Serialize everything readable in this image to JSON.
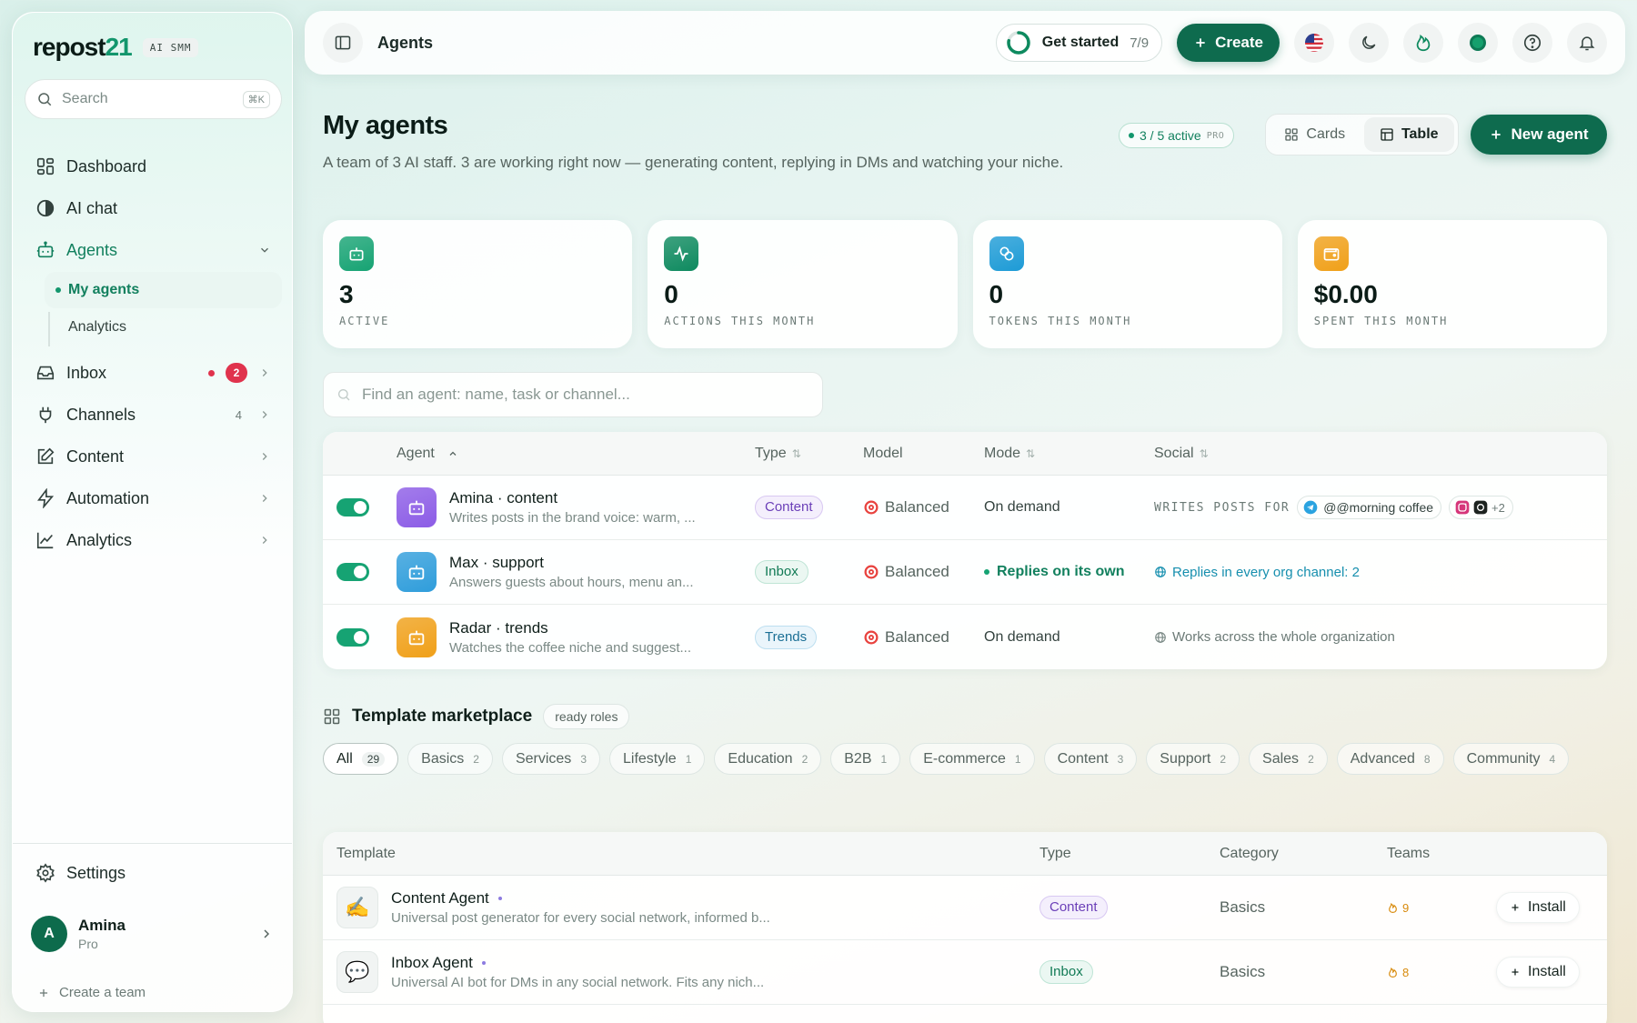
{
  "brand": {
    "logo_main": "repost",
    "logo_num": "21",
    "badge": "AI SMM"
  },
  "search": {
    "placeholder": "Search",
    "shortcut": "⌘K"
  },
  "nav": {
    "dashboard": "Dashboard",
    "ai_chat": "AI chat",
    "agents": "Agents",
    "agents_sub": [
      "My agents",
      "Analytics"
    ],
    "inbox": "Inbox",
    "inbox_count": "2",
    "channels": "Channels",
    "channels_count": "4",
    "content": "Content",
    "automation": "Automation",
    "analytics": "Analytics"
  },
  "sidebar_footer": {
    "settings": "Settings",
    "user_name": "Amina",
    "user_initial": "A",
    "user_plan": "Pro",
    "create_team": "Create a team"
  },
  "topbar": {
    "breadcrumb": "Agents",
    "get_started": "Get started",
    "get_started_progress": "7/9",
    "get_started_fraction": 0.78,
    "create": "Create"
  },
  "header": {
    "title": "My agents",
    "subtitle": "A team of 3 AI staff. 3 are working right now — generating content, replying in DMs and watching your niche.",
    "active_pill": "3 / 5 active",
    "active_pill_tier": "PRO",
    "view_cards": "Cards",
    "view_table": "Table",
    "new_agent": "New agent"
  },
  "stats": [
    {
      "value": "3",
      "label": "ACTIVE",
      "color": "#16a373"
    },
    {
      "value": "0",
      "label": "ACTIONS THIS MONTH",
      "color": "#0e8a5f"
    },
    {
      "value": "0",
      "label": "TOKENS THIS MONTH",
      "color": "#1d9bd6"
    },
    {
      "value": "$0.00",
      "label": "SPENT THIS MONTH",
      "color": "#f0a019"
    }
  ],
  "find": {
    "placeholder": "Find an agent: name, task or channel..."
  },
  "agents_table": {
    "columns": [
      "Agent",
      "Type",
      "Model",
      "Mode",
      "Social"
    ],
    "rows": [
      {
        "name": "Amina · content",
        "desc": "Writes posts in the brand voice: warm, ...",
        "type": "Content",
        "model": "Balanced",
        "mode": "On demand",
        "social_prefix": "WRITES POSTS FOR",
        "social_handle": "@@morning coffee",
        "social_more": "+2",
        "color": "#8c5ce6"
      },
      {
        "name": "Max · support",
        "desc": "Answers guests about hours, menu an...",
        "type": "Inbox",
        "model": "Balanced",
        "mode": "Replies on its own",
        "social": "Replies in every org channel: 2",
        "color": "#2f9ddb"
      },
      {
        "name": "Radar · trends",
        "desc": "Watches the coffee niche and suggest...",
        "type": "Trends",
        "model": "Balanced",
        "mode": "On demand",
        "social": "Works across the whole organization",
        "color": "#f0a019"
      }
    ]
  },
  "marketplace": {
    "title": "Template marketplace",
    "chip": "ready roles",
    "filters": [
      {
        "label": "All",
        "count": "29"
      },
      {
        "label": "Basics",
        "count": "2"
      },
      {
        "label": "Services",
        "count": "3"
      },
      {
        "label": "Lifestyle",
        "count": "1"
      },
      {
        "label": "Education",
        "count": "2"
      },
      {
        "label": "B2B",
        "count": "1"
      },
      {
        "label": "E-commerce",
        "count": "1"
      },
      {
        "label": "Content",
        "count": "3"
      },
      {
        "label": "Support",
        "count": "2"
      },
      {
        "label": "Sales",
        "count": "2"
      },
      {
        "label": "Advanced",
        "count": "8"
      },
      {
        "label": "Community",
        "count": "4"
      }
    ],
    "columns": [
      "Template",
      "Type",
      "Category",
      "Teams"
    ],
    "rows": [
      {
        "emoji": "✍️",
        "name": "Content Agent",
        "desc": "Universal post generator for every social network, informed b...",
        "type": "Content",
        "category": "Basics",
        "teams": "9",
        "action": "Install"
      },
      {
        "emoji": "💬",
        "name": "Inbox Agent",
        "desc": "Universal AI bot for DMs in any social network. Fits any nich...",
        "type": "Inbox",
        "category": "Basics",
        "teams": "8",
        "action": "Install"
      }
    ]
  }
}
